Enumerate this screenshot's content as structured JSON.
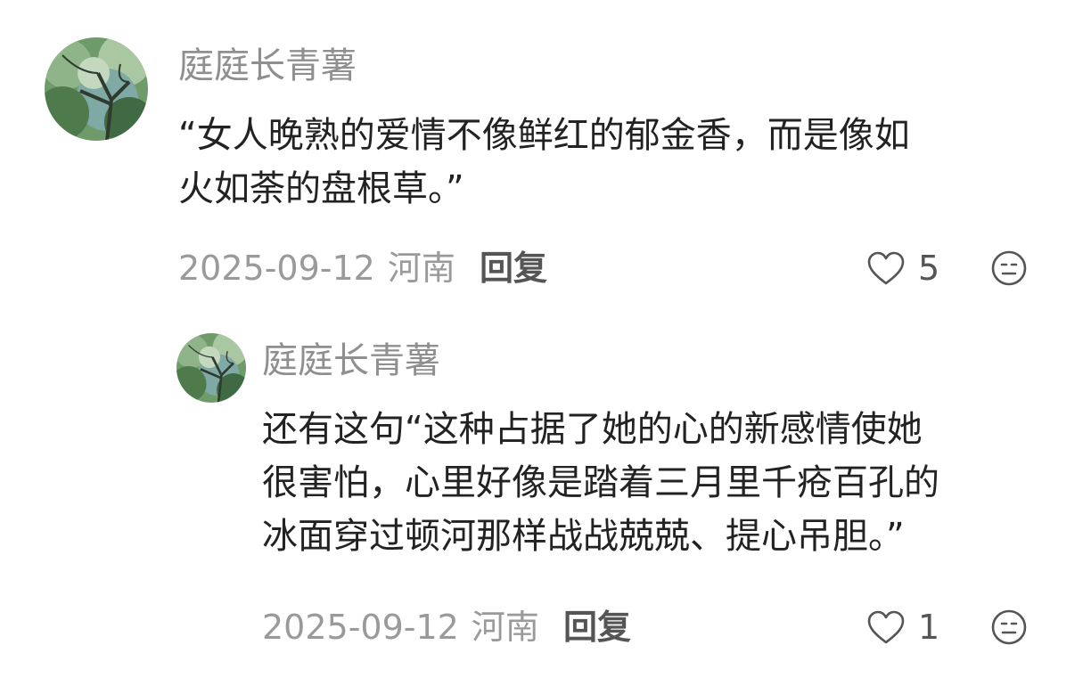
{
  "comments": [
    {
      "username": "庭庭长青薯",
      "content_lines": [
        "“女人晚熟的爱情不像鲜红的郁金香，而是像如",
        "火如荼的盘根草。”"
      ],
      "date": "2025-09-12",
      "location": "河南",
      "reply_label": "回复",
      "likes": "5",
      "icons": [
        "heart-icon",
        "dislike-face-icon"
      ]
    },
    {
      "username": "庭庭长青薯",
      "content_lines": [
        "还有这句“这种占据了她的心的新感情使她",
        "很害怕，心里好像是踏着三月里千疮百孔的",
        "冰面穿过顿河那样战战兢兢、提心吊胆。”"
      ],
      "date": "2025-09-12",
      "location": "河南",
      "reply_label": "回复",
      "likes": "1",
      "icons": [
        "heart-icon",
        "dislike-face-icon"
      ]
    }
  ],
  "colors": {
    "username": "#8f8f8f",
    "content": "#222222",
    "meta": "#9a9a9a",
    "action": "#555555",
    "avatar_green": "#5f8a5a"
  }
}
